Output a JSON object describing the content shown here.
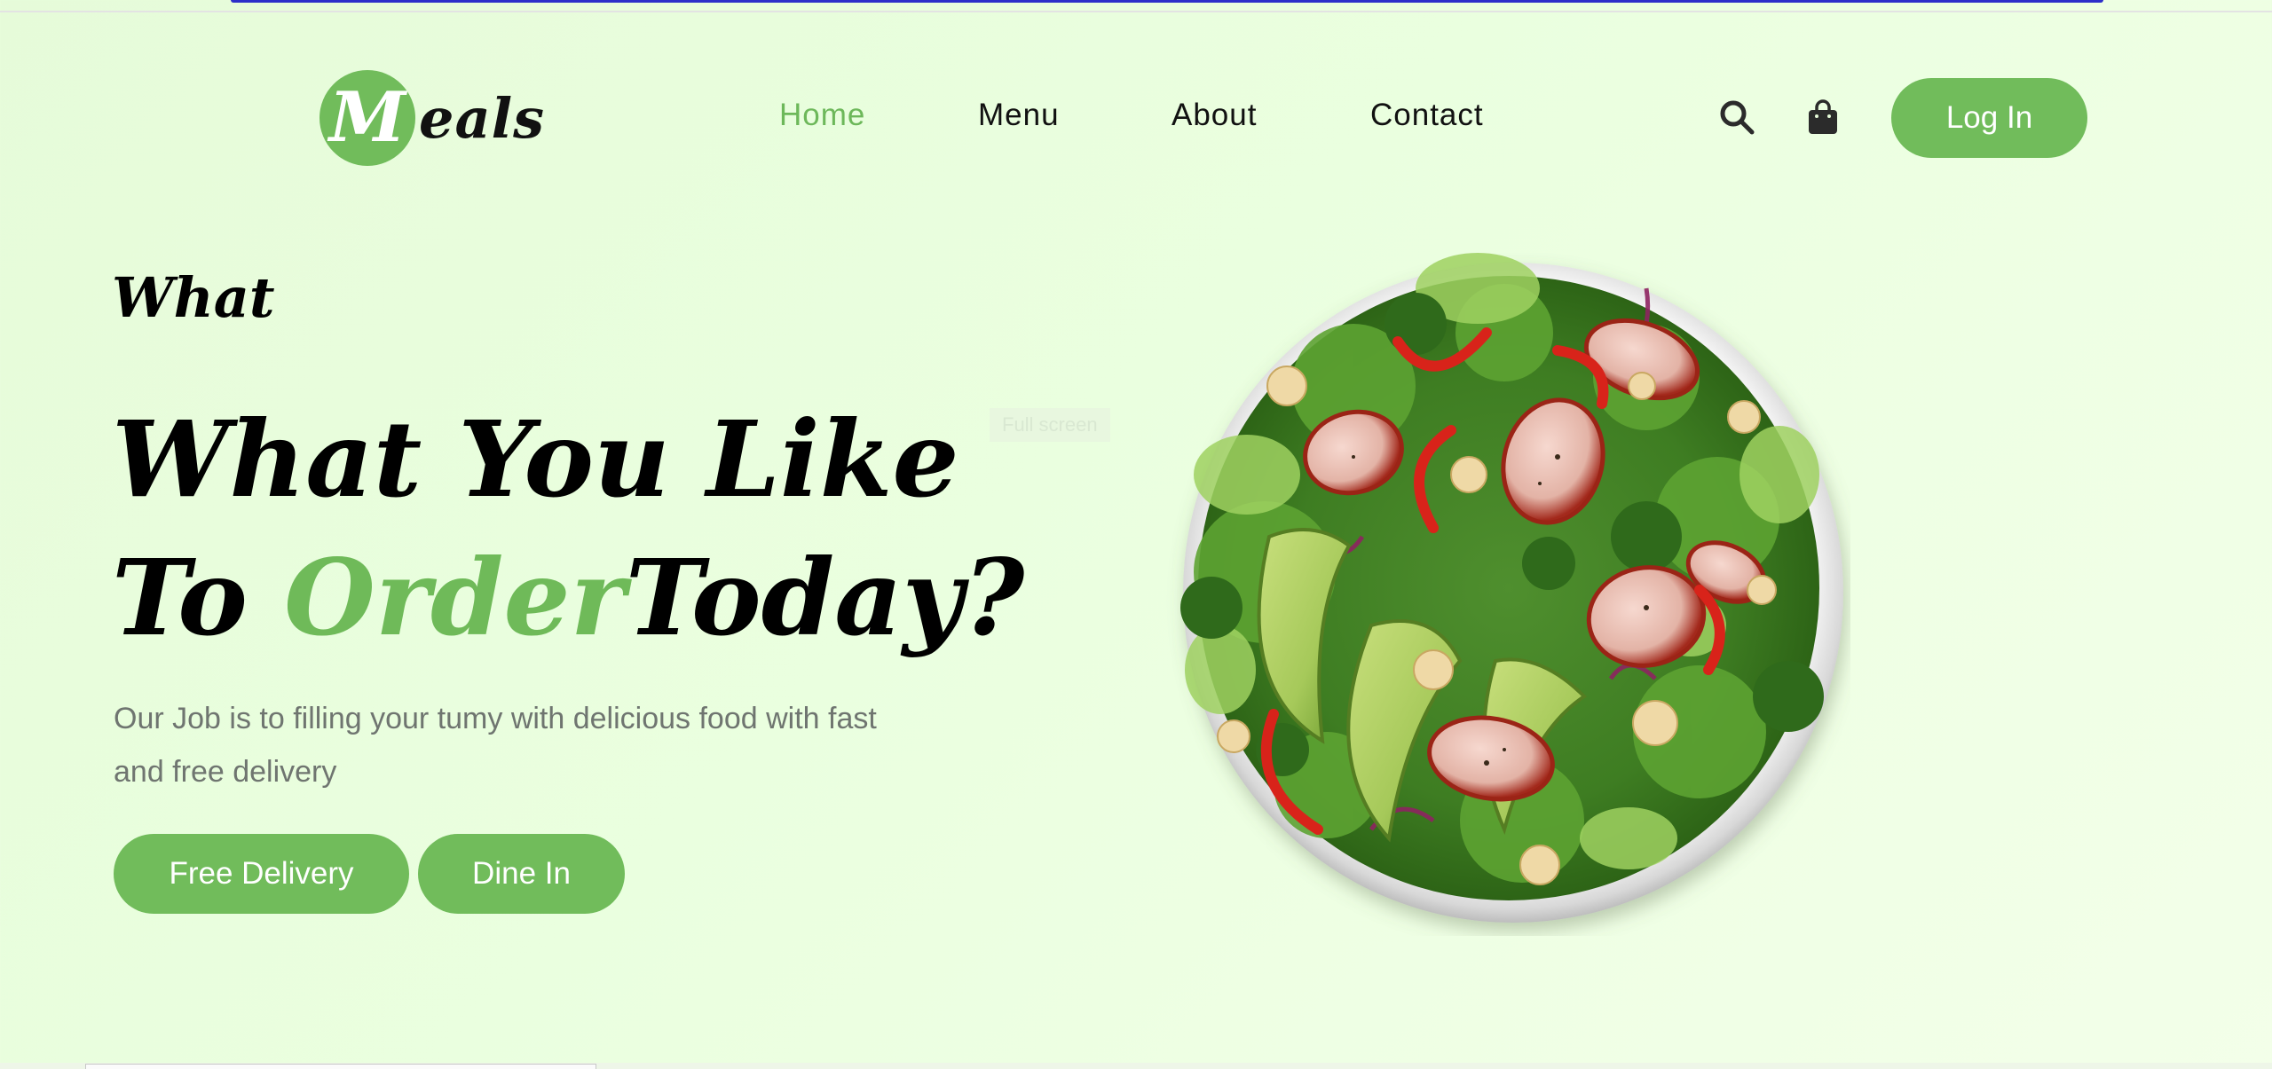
{
  "brand": {
    "logo_letter": "M",
    "logo_rest": "eals",
    "accent_color": "#71bc5b"
  },
  "nav": {
    "links": [
      {
        "label": "Home",
        "active": true
      },
      {
        "label": "Menu",
        "active": false
      },
      {
        "label": "About",
        "active": false
      },
      {
        "label": "Contact",
        "active": false
      }
    ],
    "icons": [
      "search-icon",
      "shopping-bag-icon"
    ],
    "login_label": "Log In"
  },
  "hero": {
    "kicker": "What",
    "title_line1": "What You Like",
    "title_line2_start": "To ",
    "title_accent": "Order",
    "title_line2_end": "Today?",
    "description": "Our Job is to filling your tumy with delicious food with fast and free delivery",
    "buttons": {
      "free_delivery": "Free Delivery",
      "dine_in": "Dine In"
    }
  },
  "overlay": {
    "ghost_tooltip": "Full screen"
  }
}
